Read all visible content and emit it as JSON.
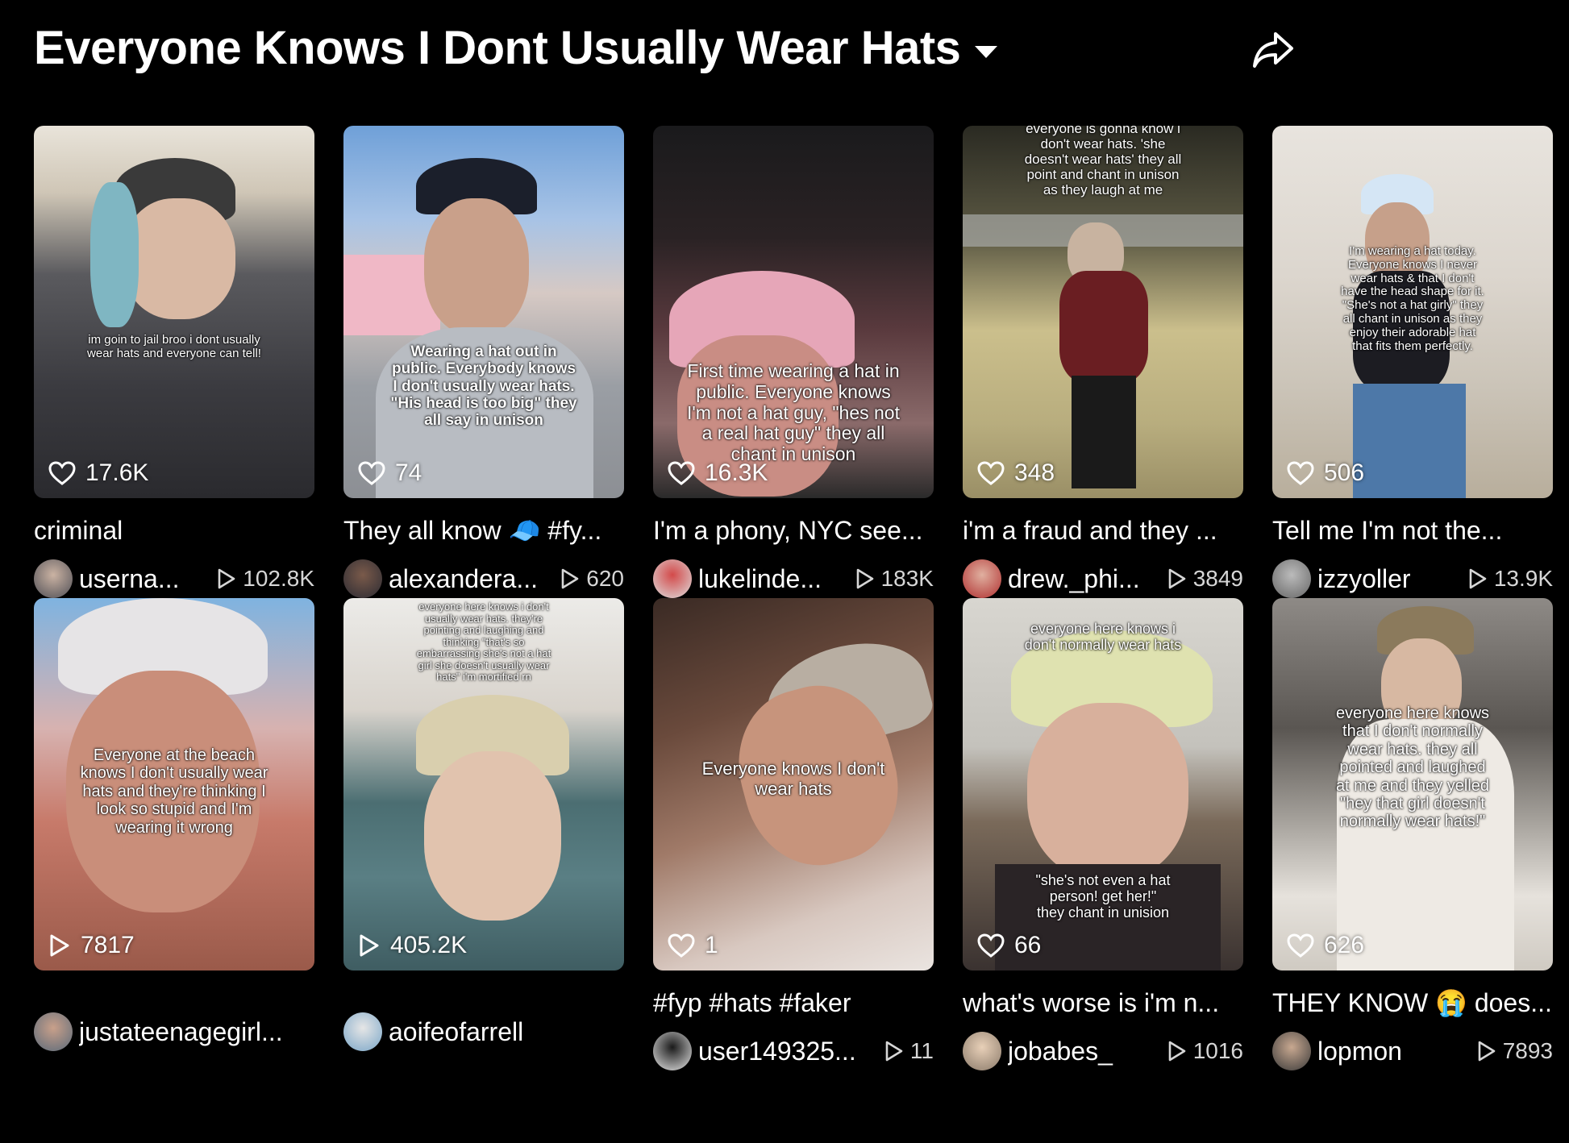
{
  "header": {
    "title": "Everyone Knows I Dont Usually Wear Hats"
  },
  "videos": [
    {
      "overlay": "im goin to jail broo i dont usually\nwear hats and everyone can tell!",
      "stat": "17.6K",
      "stat_icon": "heart-icon",
      "caption": "criminal",
      "author": "userna...",
      "views": "102.8K"
    },
    {
      "overlay": "Wearing a hat out in\npublic. Everybody knows\nI don't usually wear hats.\n\"His head is too big\" they\nall say in unison",
      "stat": "74",
      "stat_icon": "heart-icon",
      "caption": "They all know 🧢 #fy...",
      "author": "alexandera...",
      "views": "620"
    },
    {
      "overlay": "First time wearing a hat in\npublic. Everyone knows\nI'm not a hat guy, \"hes not\na real hat guy\" they all\nchant in unison",
      "stat": "16.3K",
      "stat_icon": "heart-icon",
      "caption": "I'm a phony, NYC see...",
      "author": "lukelinde...",
      "views": "183K"
    },
    {
      "overlay": "everyone is gonna know i\ndon't wear hats. 'she\ndoesn't wear hats' they all\npoint and chant in unison\nas they laugh at me",
      "stat": "348",
      "stat_icon": "heart-icon",
      "caption": "i'm a fraud and they ...",
      "author": "drew._phi...",
      "views": "3849"
    },
    {
      "overlay": "I'm wearing a hat today.\nEveryone knows I never\nwear hats & that I don't\nhave the head shape for it.\n\"She's not a hat girly\" they\nall chant in unison as they\nenjoy their adorable hat\nthat fits them perfectly.",
      "stat": "506",
      "stat_icon": "heart-icon",
      "caption": "Tell me I'm not the...",
      "author": "izzyoller",
      "views": "13.9K"
    },
    {
      "overlay": "Everyone at the beach\nknows I don't usually wear\nhats and they're thinking I\nlook so stupid and I'm\nwearing it wrong",
      "stat": "7817",
      "stat_icon": "play-icon",
      "caption": "",
      "author": "justateenagegirl...",
      "views": ""
    },
    {
      "overlay": "everyone here knows i don't\nusually wear hats. they're\npointing and laughing and\nthinking \"that's so\nembarrassing she's not a hat\ngirl she doesn't usually wear\nhats\" i'm mortified rn",
      "stat": "405.2K",
      "stat_icon": "play-icon",
      "caption": "",
      "author": "aoifeofarrell",
      "views": ""
    },
    {
      "overlay": "Everyone knows I don't\nwear hats",
      "stat": "1",
      "stat_icon": "heart-icon",
      "caption": "#fyp #hats #faker",
      "author": "user149325...",
      "views": "11"
    },
    {
      "overlay": "everyone here knows i\ndon't normally wear hats",
      "overlay2": "\"she's not even a hat\nperson! get her!\"\nthey chant in unision",
      "stat": "66",
      "stat_icon": "heart-icon",
      "caption": "what's worse is i'm n...",
      "author": "jobabes_",
      "views": "1016"
    },
    {
      "overlay": "everyone here knows\nthat I don't normally\nwear hats. they all\npointed and laughed\nat me and they yelled\n\"hey that girl doesn't\nnormally wear hats!\"",
      "stat": "626",
      "stat_icon": "heart-icon",
      "caption": "THEY KNOW 😭 does...",
      "author": "lopmon",
      "views": "7893"
    }
  ],
  "colors": {
    "background": "#000000",
    "text": "#ffffff",
    "muted": "#d6d6d6"
  }
}
